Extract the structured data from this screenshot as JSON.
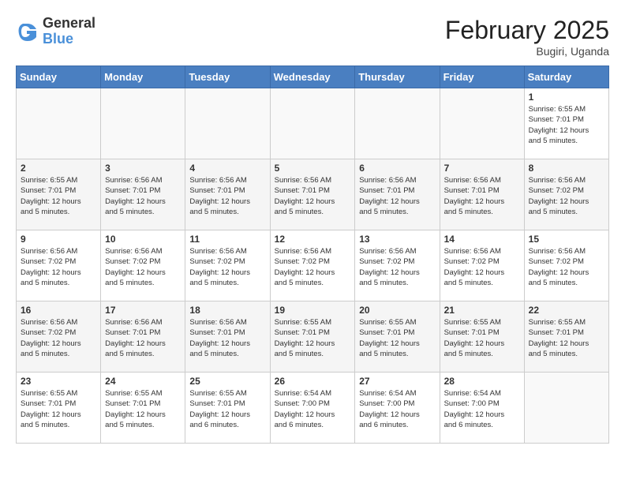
{
  "header": {
    "logo": {
      "line1": "General",
      "line2": "Blue"
    },
    "title": "February 2025",
    "subtitle": "Bugiri, Uganda"
  },
  "weekdays": [
    "Sunday",
    "Monday",
    "Tuesday",
    "Wednesday",
    "Thursday",
    "Friday",
    "Saturday"
  ],
  "weeks": [
    [
      {
        "day": "",
        "info": ""
      },
      {
        "day": "",
        "info": ""
      },
      {
        "day": "",
        "info": ""
      },
      {
        "day": "",
        "info": ""
      },
      {
        "day": "",
        "info": ""
      },
      {
        "day": "",
        "info": ""
      },
      {
        "day": "1",
        "info": "Sunrise: 6:55 AM\nSunset: 7:01 PM\nDaylight: 12 hours\nand 5 minutes."
      }
    ],
    [
      {
        "day": "2",
        "info": "Sunrise: 6:55 AM\nSunset: 7:01 PM\nDaylight: 12 hours\nand 5 minutes."
      },
      {
        "day": "3",
        "info": "Sunrise: 6:56 AM\nSunset: 7:01 PM\nDaylight: 12 hours\nand 5 minutes."
      },
      {
        "day": "4",
        "info": "Sunrise: 6:56 AM\nSunset: 7:01 PM\nDaylight: 12 hours\nand 5 minutes."
      },
      {
        "day": "5",
        "info": "Sunrise: 6:56 AM\nSunset: 7:01 PM\nDaylight: 12 hours\nand 5 minutes."
      },
      {
        "day": "6",
        "info": "Sunrise: 6:56 AM\nSunset: 7:01 PM\nDaylight: 12 hours\nand 5 minutes."
      },
      {
        "day": "7",
        "info": "Sunrise: 6:56 AM\nSunset: 7:01 PM\nDaylight: 12 hours\nand 5 minutes."
      },
      {
        "day": "8",
        "info": "Sunrise: 6:56 AM\nSunset: 7:02 PM\nDaylight: 12 hours\nand 5 minutes."
      }
    ],
    [
      {
        "day": "9",
        "info": "Sunrise: 6:56 AM\nSunset: 7:02 PM\nDaylight: 12 hours\nand 5 minutes."
      },
      {
        "day": "10",
        "info": "Sunrise: 6:56 AM\nSunset: 7:02 PM\nDaylight: 12 hours\nand 5 minutes."
      },
      {
        "day": "11",
        "info": "Sunrise: 6:56 AM\nSunset: 7:02 PM\nDaylight: 12 hours\nand 5 minutes."
      },
      {
        "day": "12",
        "info": "Sunrise: 6:56 AM\nSunset: 7:02 PM\nDaylight: 12 hours\nand 5 minutes."
      },
      {
        "day": "13",
        "info": "Sunrise: 6:56 AM\nSunset: 7:02 PM\nDaylight: 12 hours\nand 5 minutes."
      },
      {
        "day": "14",
        "info": "Sunrise: 6:56 AM\nSunset: 7:02 PM\nDaylight: 12 hours\nand 5 minutes."
      },
      {
        "day": "15",
        "info": "Sunrise: 6:56 AM\nSunset: 7:02 PM\nDaylight: 12 hours\nand 5 minutes."
      }
    ],
    [
      {
        "day": "16",
        "info": "Sunrise: 6:56 AM\nSunset: 7:02 PM\nDaylight: 12 hours\nand 5 minutes."
      },
      {
        "day": "17",
        "info": "Sunrise: 6:56 AM\nSunset: 7:01 PM\nDaylight: 12 hours\nand 5 minutes."
      },
      {
        "day": "18",
        "info": "Sunrise: 6:56 AM\nSunset: 7:01 PM\nDaylight: 12 hours\nand 5 minutes."
      },
      {
        "day": "19",
        "info": "Sunrise: 6:55 AM\nSunset: 7:01 PM\nDaylight: 12 hours\nand 5 minutes."
      },
      {
        "day": "20",
        "info": "Sunrise: 6:55 AM\nSunset: 7:01 PM\nDaylight: 12 hours\nand 5 minutes."
      },
      {
        "day": "21",
        "info": "Sunrise: 6:55 AM\nSunset: 7:01 PM\nDaylight: 12 hours\nand 5 minutes."
      },
      {
        "day": "22",
        "info": "Sunrise: 6:55 AM\nSunset: 7:01 PM\nDaylight: 12 hours\nand 5 minutes."
      }
    ],
    [
      {
        "day": "23",
        "info": "Sunrise: 6:55 AM\nSunset: 7:01 PM\nDaylight: 12 hours\nand 5 minutes."
      },
      {
        "day": "24",
        "info": "Sunrise: 6:55 AM\nSunset: 7:01 PM\nDaylight: 12 hours\nand 5 minutes."
      },
      {
        "day": "25",
        "info": "Sunrise: 6:55 AM\nSunset: 7:01 PM\nDaylight: 12 hours\nand 6 minutes."
      },
      {
        "day": "26",
        "info": "Sunrise: 6:54 AM\nSunset: 7:00 PM\nDaylight: 12 hours\nand 6 minutes."
      },
      {
        "day": "27",
        "info": "Sunrise: 6:54 AM\nSunset: 7:00 PM\nDaylight: 12 hours\nand 6 minutes."
      },
      {
        "day": "28",
        "info": "Sunrise: 6:54 AM\nSunset: 7:00 PM\nDaylight: 12 hours\nand 6 minutes."
      },
      {
        "day": "",
        "info": ""
      }
    ]
  ]
}
